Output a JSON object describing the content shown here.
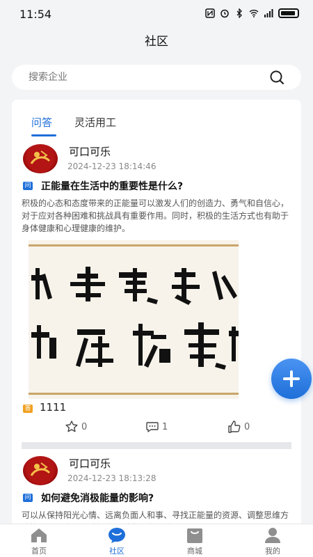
{
  "status": {
    "time": "11:54"
  },
  "nav": {
    "title": "社区"
  },
  "search": {
    "placeholder": "搜索企业"
  },
  "tabs": [
    {
      "label": "问答"
    },
    {
      "label": "灵活用工"
    }
  ],
  "posts": [
    {
      "user": "可口可乐",
      "time": "2024-12-23 18:14:46",
      "question": "正能量在生活中的重要性是什么?",
      "body": "积极的心态和态度带来的正能量可以激发人们的创造力、勇气和自信心，对于应对各种困难和挑战具有重要作用。同时，积极的生活方式也有助于身体健康和心理健康的维护。",
      "answer": "1111",
      "likes": "0",
      "comments": "1",
      "thumbs": "0"
    },
    {
      "user": "可口可乐",
      "time": "2024-12-23 18:13:28",
      "question": "如何避免消极能量的影响?",
      "body": "可以从保持阳光心情、远离负面人和事、寻找正能量的资源、调整思维方式等方面，来避免消极能量对自己的影响。"
    }
  ],
  "badges": {
    "question": "问",
    "answer": "答"
  },
  "tabbar": [
    {
      "label": "首页"
    },
    {
      "label": "社区"
    },
    {
      "label": "商城"
    },
    {
      "label": "我的"
    }
  ],
  "colors": {
    "accent": "#1e6fd9",
    "answer_badge": "#f0a020"
  }
}
